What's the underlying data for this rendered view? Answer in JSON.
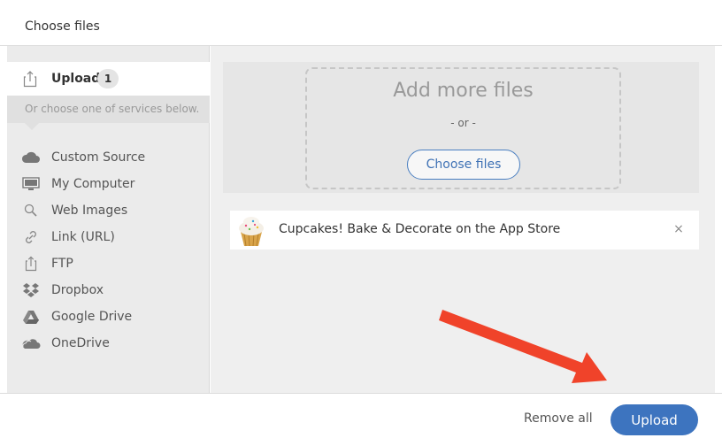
{
  "header": {
    "title": "Choose files"
  },
  "sidebar": {
    "upload_tab": {
      "label": "Upload",
      "count": "1"
    },
    "services_hint": "Or choose one of services below.",
    "services": [
      {
        "label": "Custom Source",
        "icon": "cloud-icon"
      },
      {
        "label": "My Computer",
        "icon": "monitor-icon"
      },
      {
        "label": "Web Images",
        "icon": "search-icon"
      },
      {
        "label": "Link (URL)",
        "icon": "link-icon"
      },
      {
        "label": "FTP",
        "icon": "upload-icon"
      },
      {
        "label": "Dropbox",
        "icon": "dropbox-icon"
      },
      {
        "label": "Google Drive",
        "icon": "google-drive-icon"
      },
      {
        "label": "OneDrive",
        "icon": "onedrive-icon"
      }
    ]
  },
  "main": {
    "dropzone": {
      "title": "Add more files",
      "or_text": "- or -",
      "choose_label": "Choose files"
    },
    "files": [
      {
        "name": "Cupcakes! Bake & Decorate on the App Store",
        "thumbnail": "cupcake-thumbnail",
        "remove_glyph": "×"
      }
    ]
  },
  "footer": {
    "remove_all_label": "Remove all",
    "upload_label": "Upload"
  },
  "colors": {
    "accent": "#3d74bf",
    "arrow": "#f0432a",
    "sidebar_bg": "#ebebeb",
    "main_bg": "#efefef"
  }
}
